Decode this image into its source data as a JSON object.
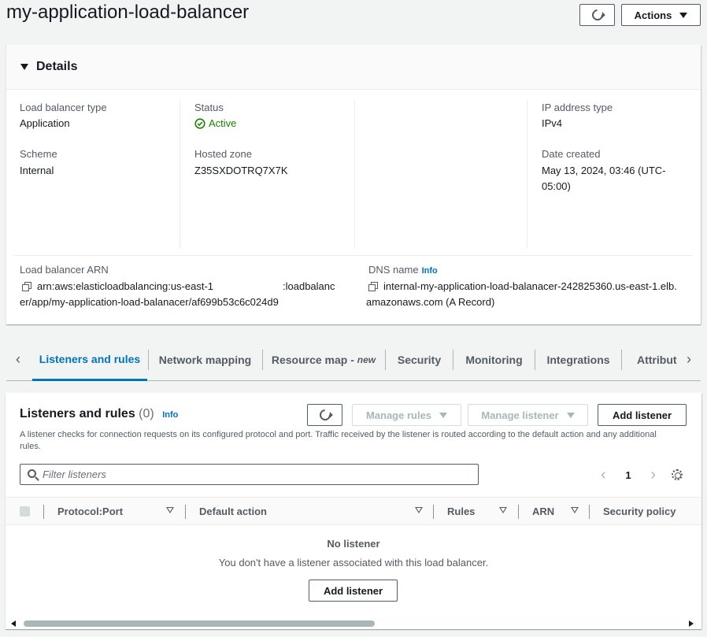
{
  "page": {
    "title": "my-application-load-balancer"
  },
  "header": {
    "actions_label": "Actions"
  },
  "details": {
    "heading": "Details",
    "lb_type_label": "Load balancer type",
    "lb_type_value": "Application",
    "status_label": "Status",
    "status_value": "Active",
    "ip_type_label": "IP address type",
    "ip_type_value": "IPv4",
    "scheme_label": "Scheme",
    "scheme_value": "Internal",
    "hosted_zone_label": "Hosted zone",
    "hosted_zone_value": "Z35SXDOTRQ7X7K",
    "date_label": "Date created",
    "date_value_line1": "May 13, 2024, 03:46 (UTC-",
    "date_value_line2": "05:00)",
    "arn_label": "Load balancer ARN",
    "arn_line1": "arn:aws:elasticloadbalancing:us-east-1",
    "arn_line1b": ":loadbalanc",
    "arn_line2": "er/app/my-application-load-balanacer/af699b53c6c024d9",
    "dns_label": "DNS name",
    "dns_info": "Info",
    "dns_line1": "internal-my-application-load-balanacer-242825360.us-east-1.elb.",
    "dns_line2": "amazonaws.com (A Record)"
  },
  "tabs": [
    {
      "label": "Listeners and rules"
    },
    {
      "label": "Network mapping"
    },
    {
      "label": "Resource map - ",
      "suffix": "new"
    },
    {
      "label": "Security"
    },
    {
      "label": "Monitoring"
    },
    {
      "label": "Integrations"
    },
    {
      "label": "Attribut"
    }
  ],
  "listeners": {
    "title": "Listeners and rules",
    "count": "(0)",
    "info": "Info",
    "manage_rules_label": "Manage rules",
    "manage_listener_label": "Manage listener",
    "add_listener_label": "Add listener",
    "description": "A listener checks for connection requests on its configured protocol and port. Traffic received by the listener is routed according to the default action and any additional rules.",
    "filter_placeholder": "Filter listeners",
    "page_number": "1",
    "columns": [
      "Protocol:Port",
      "Default action",
      "Rules",
      "ARN",
      "Security policy"
    ],
    "empty_title": "No listener",
    "empty_subtitle": "You don't have a listener associated with this load balancer.",
    "empty_button_label": "Add listener"
  },
  "colors": {
    "accent": "#0073bb",
    "success": "#1d8102",
    "text": "#16191f",
    "muted": "#545b64"
  }
}
